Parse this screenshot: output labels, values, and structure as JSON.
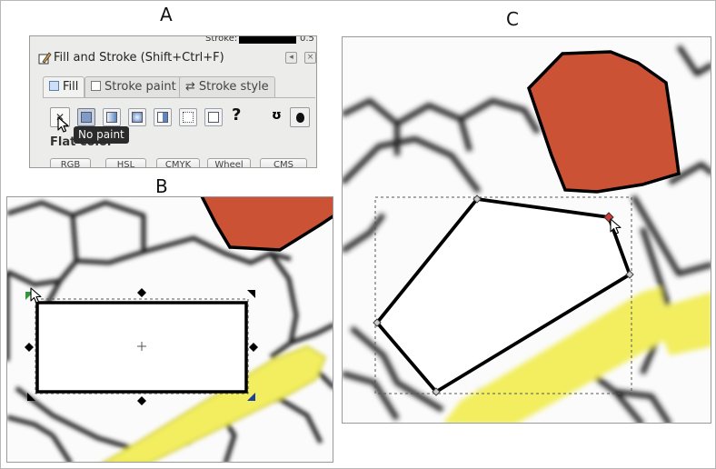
{
  "labels": {
    "a": "A",
    "b": "B",
    "c": "C"
  },
  "dialog": {
    "stroke_label": "Stroke:",
    "stroke_value": "0.5",
    "title": "Fill and Stroke (Shift+Ctrl+F)",
    "tabs": [
      {
        "label": "Fill",
        "active": true
      },
      {
        "label": "Stroke paint",
        "active": false
      },
      {
        "label": "Stroke style",
        "active": false
      }
    ],
    "paint_buttons": [
      "no-paint",
      "flat-color",
      "linear-gradient",
      "radial-gradient",
      "pattern",
      "swatch",
      "unset"
    ],
    "x_glyph": "✕",
    "unset_glyph": "?",
    "evenodd_glyph": "ʊ",
    "tooltip": "No paint",
    "flat_label": "Flat color",
    "color_modes": [
      "RGB",
      "HSL",
      "CMYK",
      "Wheel",
      "CMS"
    ]
  },
  "colors": {
    "accent_red": "#cc5236",
    "highlight_yellow": "#f2ee5e",
    "tooltip_bg": "#2b2b2b",
    "stroke_black": "#000000"
  },
  "icons": {
    "dialog": "pen-icon",
    "selection": "bounding-box-handles",
    "cursor": "arrow-cursor-icon",
    "node": "diamond-node-icon"
  }
}
